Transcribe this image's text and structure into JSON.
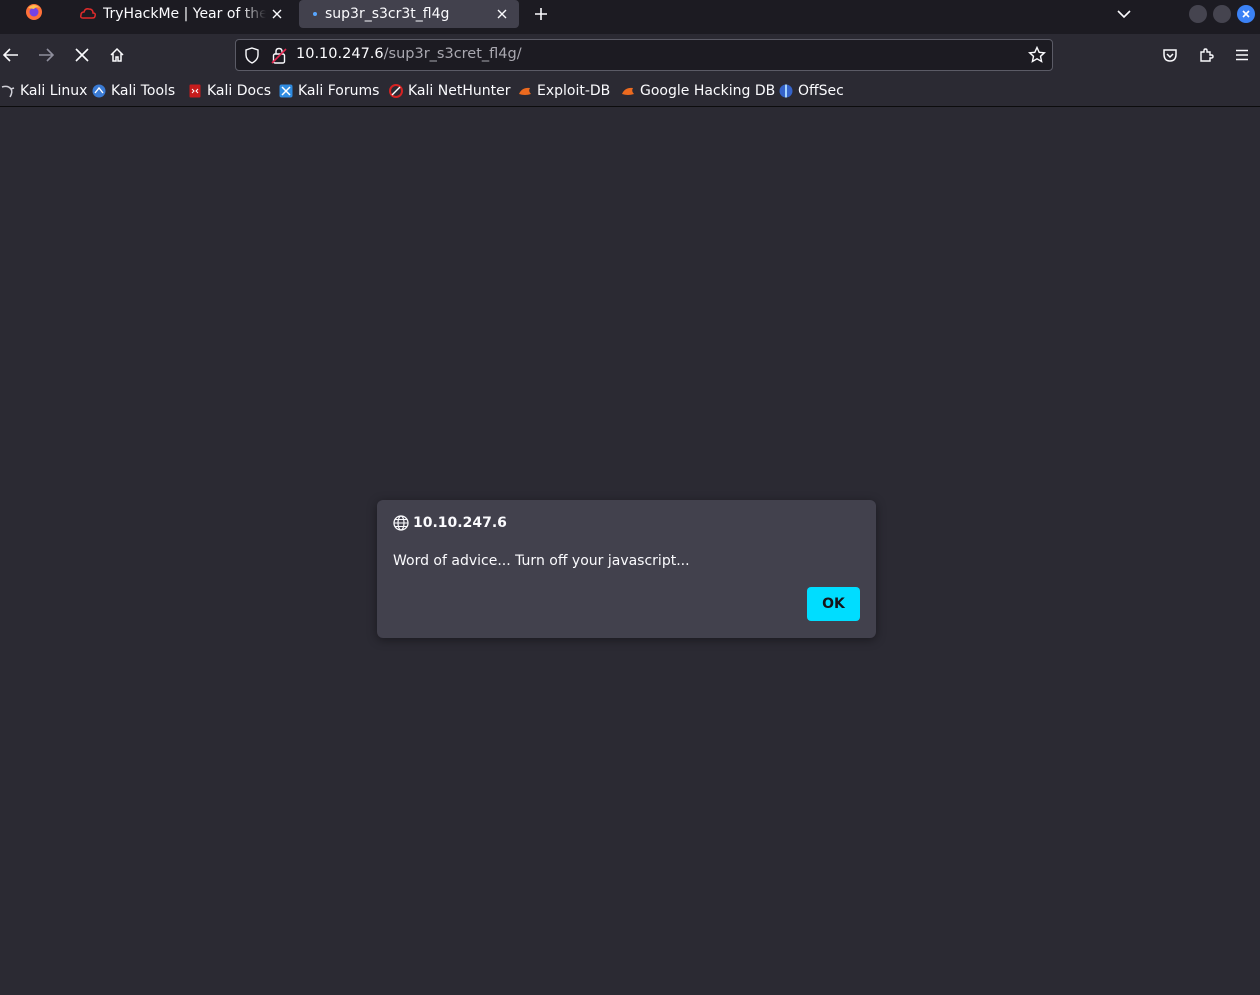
{
  "tabs": [
    {
      "title": "TryHackMe | Year of the Rabbit"
    },
    {
      "title": "sup3r_s3cr3t_fl4g"
    }
  ],
  "url": {
    "host": "10.10.247.6",
    "path": "/sup3r_s3cret_fl4g/"
  },
  "bookmarks": [
    {
      "label": "Kali Linux",
      "icon": "kali-dragon-icon"
    },
    {
      "label": "Kali Tools",
      "icon": "kali-tools-icon"
    },
    {
      "label": "Kali Docs",
      "icon": "kali-docs-icon"
    },
    {
      "label": "Kali Forums",
      "icon": "kali-forums-icon"
    },
    {
      "label": "Kali NetHunter",
      "icon": "nethunter-icon"
    },
    {
      "label": "Exploit-DB",
      "icon": "exploit-db-icon"
    },
    {
      "label": "Google Hacking DB",
      "icon": "ghdb-icon"
    },
    {
      "label": "OffSec",
      "icon": "offsec-icon"
    }
  ],
  "dialog": {
    "origin": "10.10.247.6",
    "message": "Word of advice... Turn off your javascript...",
    "ok_label": "OK"
  },
  "colors": {
    "accent": "#00ddff",
    "page_bg": "#2b2a33",
    "tabbar_bg": "#1c1b22"
  }
}
